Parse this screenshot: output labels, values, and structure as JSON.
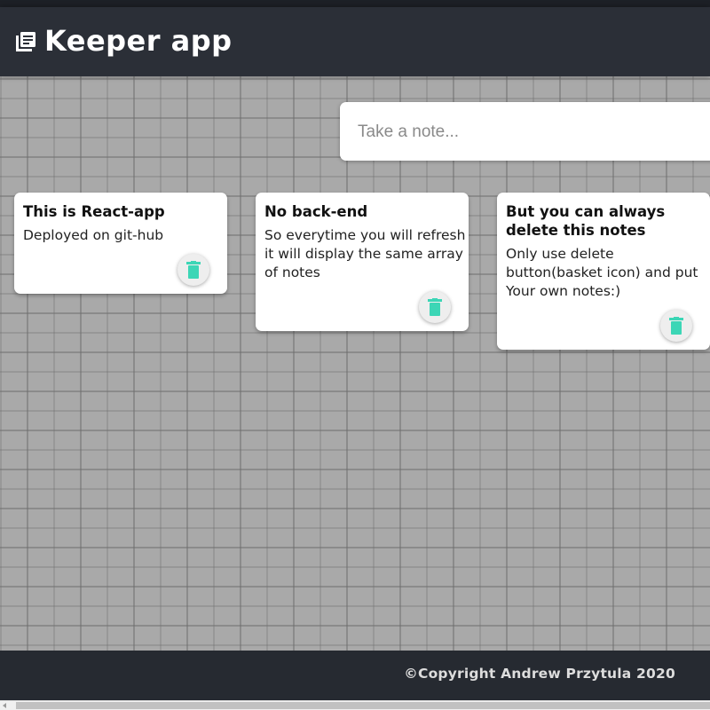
{
  "header": {
    "title": "Keeper app",
    "icon": "notes-icon"
  },
  "create_note": {
    "placeholder": "Take a note..."
  },
  "notes": [
    {
      "title": "This is React-app",
      "content": "Deployed on git-hub",
      "delete_icon": "trash-icon"
    },
    {
      "title": "No back-end",
      "content": "So everytime you will refresh it will display the same array of notes",
      "delete_icon": "trash-icon"
    },
    {
      "title": "But you can always delete this notes",
      "content": "Only use delete button(basket icon) and put Your own notes:)",
      "delete_icon": "trash-icon"
    }
  ],
  "footer": {
    "copyright": "©Copyright Andrew Przytula 2020"
  },
  "colors": {
    "header_bg": "#2b2f37",
    "footer_bg": "#262a31",
    "delete_icon": "#3cd6b6",
    "note_bg": "#ffffff",
    "wall_bg": "#a9a9a9"
  }
}
